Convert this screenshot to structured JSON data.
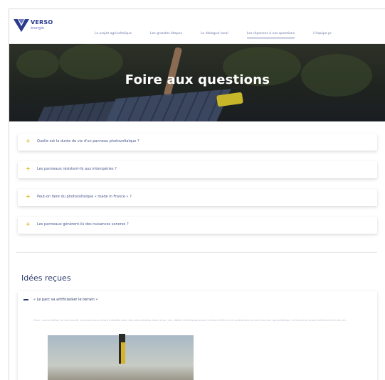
{
  "brand": {
    "name": "VERSO",
    "tagline": "énergie",
    "colors": {
      "primary": "#2a3a8c",
      "accent": "#e0b41b",
      "text": "#4a5890"
    }
  },
  "nav": {
    "items": [
      {
        "label": "Le projet agrivoltaïque",
        "active": false
      },
      {
        "label": "Les grandes étapes",
        "active": false
      },
      {
        "label": "Le dialogue local",
        "active": false
      },
      {
        "label": "Les réponses à vos questions",
        "active": true
      },
      {
        "label": "L'équipe pr",
        "active": false
      }
    ]
  },
  "hero": {
    "title": "Foire aux questions"
  },
  "faq": {
    "items": [
      {
        "icon": "plus-icon",
        "question": "Quelle est la durée de vie d'un panneau photovoltaïque ?"
      },
      {
        "icon": "plus-icon",
        "question": "Les panneaux résistent-ils aux intempéries ?"
      },
      {
        "icon": "plus-icon",
        "question": "Peut-on faire du photovoltaïque « made in France » ?"
      },
      {
        "icon": "plus-icon",
        "question": "Les panneaux génèrent-ils des nuisances sonores ?"
      }
    ]
  },
  "ideas": {
    "title": "Idées reçues",
    "item": {
      "icon": "minus-icon",
      "title": "« Le parc va artificialiser le terrain »",
      "body": "Faux : aucun béton ne sera coulé. Les panneaux seront installés avec des pieux battus dans le sol. Les câbles électriques seront enfouis à 80 cm de profondeur au sein du parc agrivoltaïque, et les pieux seront retirés à la fin de vie."
    }
  }
}
